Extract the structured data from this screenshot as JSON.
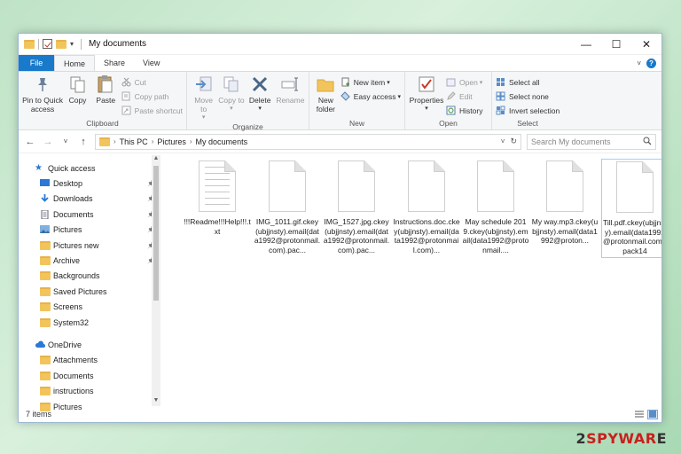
{
  "window": {
    "title": "My documents",
    "controls": {
      "minimize": "—",
      "maximize": "☐",
      "close": "✕"
    }
  },
  "tabs": [
    {
      "label": "File"
    },
    {
      "label": "Home"
    },
    {
      "label": "Share"
    },
    {
      "label": "View"
    }
  ],
  "ribbon": {
    "clipboard": {
      "label": "Clipboard",
      "pin": "Pin to Quick access",
      "copy": "Copy",
      "paste": "Paste",
      "cut": "Cut",
      "copy_path": "Copy path",
      "paste_shortcut": "Paste shortcut"
    },
    "organize": {
      "label": "Organize",
      "move_to": "Move to",
      "copy_to": "Copy to",
      "delete": "Delete",
      "rename": "Rename"
    },
    "new": {
      "label": "New",
      "new_folder": "New folder",
      "new_item": "New item",
      "easy_access": "Easy access"
    },
    "open": {
      "label": "Open",
      "properties": "Properties",
      "open": "Open",
      "edit": "Edit",
      "history": "History"
    },
    "select": {
      "label": "Select",
      "select_all": "Select all",
      "select_none": "Select none",
      "invert_selection": "Invert selection"
    }
  },
  "address": {
    "crumbs": [
      "This PC",
      "Pictures",
      "My documents"
    ],
    "search_placeholder": "Search My documents"
  },
  "sidebar": {
    "quick_access": "Quick access",
    "items": [
      {
        "label": "Desktop",
        "pinned": true
      },
      {
        "label": "Downloads",
        "pinned": true
      },
      {
        "label": "Documents",
        "pinned": true
      },
      {
        "label": "Pictures",
        "pinned": true
      },
      {
        "label": "Pictures new",
        "pinned": true
      },
      {
        "label": "Archive",
        "pinned": true
      },
      {
        "label": "Backgrounds",
        "pinned": false
      },
      {
        "label": "Saved Pictures",
        "pinned": false
      },
      {
        "label": "Screens",
        "pinned": false
      },
      {
        "label": "System32",
        "pinned": false
      }
    ],
    "onedrive": "OneDrive",
    "onedrive_items": [
      {
        "label": "Attachments"
      },
      {
        "label": "Documents"
      },
      {
        "label": "instructions"
      },
      {
        "label": "Pictures"
      }
    ]
  },
  "files": [
    {
      "name": "!!!Readme!!!Help!!!.txt",
      "lined": true,
      "selected": false
    },
    {
      "name": "IMG_1011.gif.ckey(ubjjnsty).email(data1992@protonmail.com).pac...",
      "lined": false,
      "selected": false
    },
    {
      "name": "IMG_1527.jpg.ckey(ubjjnsty).email(data1992@protonmail.com).pac...",
      "lined": false,
      "selected": false
    },
    {
      "name": "Instructions.doc.ckey(ubjjnsty).email(data1992@protonmail.com)...",
      "lined": false,
      "selected": false
    },
    {
      "name": "May schedule 2019.ckey(ubjjnsty).email(data1992@protonmail....",
      "lined": false,
      "selected": false
    },
    {
      "name": "My way.mp3.ckey(ubjjnsty).email(data1992@proton...",
      "lined": false,
      "selected": false
    },
    {
      "name": "Till.pdf.ckey(ubjjnsty).email(data1992@protonmail.com).pack14",
      "lined": false,
      "selected": true
    }
  ],
  "status": {
    "item_count": "7 items"
  },
  "watermark": {
    "prefix": "2",
    "red": "SPYWAR",
    "suffix": "E"
  }
}
